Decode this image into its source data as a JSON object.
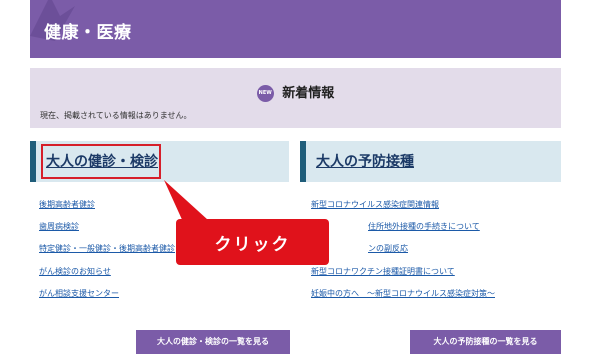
{
  "header": {
    "title": "健康・医療"
  },
  "news": {
    "badge": "NEW",
    "title": "新着情報",
    "message": "現在、掲載されている情報はありません。"
  },
  "left_column": {
    "title": "大人の健診・検診",
    "links": [
      "後期高齢者健診",
      "歯周病検診",
      "特定健診・一般健診・後期高齢者健診",
      "がん検診のお知らせ",
      "がん相談支援センター"
    ],
    "more_button": "大人の健診・検診の一覧を見る"
  },
  "right_column": {
    "title": "大人の予防接種",
    "links": [
      "新型コロナウイルス感染症関連情報",
      "住所地外接種の手続きについて",
      "ンの副反応",
      "新型コロナワクチン接種証明書について",
      "妊娠中の方へ　～新型コロナウイルス感染症対策～"
    ],
    "more_button": "大人の予防接種の一覧を見る"
  },
  "callout": {
    "text": "クリック"
  },
  "colors": {
    "header_purple": "#7b5ca8",
    "news_bg": "#e3dcea",
    "column_head_bg": "#d9e8ef",
    "link_blue": "#1c5aa8",
    "callout_red": "#e0121b"
  }
}
